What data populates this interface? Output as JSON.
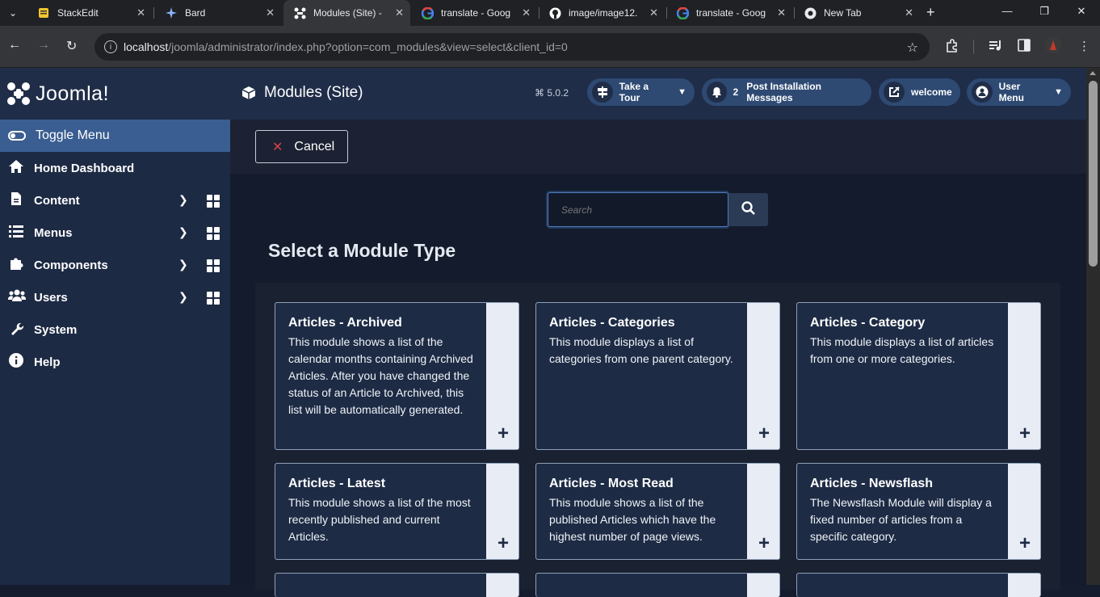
{
  "browser": {
    "tabs": [
      {
        "title": "StackEdit",
        "icon": "stackedit-icon",
        "active": false
      },
      {
        "title": "Bard",
        "icon": "bard-icon",
        "active": false
      },
      {
        "title": "Modules (Site) -",
        "icon": "joomla-icon",
        "active": true
      },
      {
        "title": "translate - Goog",
        "icon": "google-icon",
        "active": false
      },
      {
        "title": "image/image12.",
        "icon": "github-icon",
        "active": false
      },
      {
        "title": "translate - Goog",
        "icon": "google-icon",
        "active": false
      },
      {
        "title": "New Tab",
        "icon": "chrome-icon",
        "active": false
      }
    ],
    "url_host": "localhost",
    "url_path": "/joomla/administrator/index.php?option=com_modules&view=select&client_id=0"
  },
  "sidebar": {
    "logo": "Joomla!",
    "toggle_label": "Toggle Menu",
    "items": [
      {
        "label": "Home Dashboard",
        "icon": "home-icon",
        "has_submenu": false
      },
      {
        "label": "Content",
        "icon": "file-icon",
        "has_submenu": true
      },
      {
        "label": "Menus",
        "icon": "list-icon",
        "has_submenu": true
      },
      {
        "label": "Components",
        "icon": "puzzle-icon",
        "has_submenu": true
      },
      {
        "label": "Users",
        "icon": "users-icon",
        "has_submenu": true
      },
      {
        "label": "System",
        "icon": "wrench-icon",
        "has_submenu": false
      },
      {
        "label": "Help",
        "icon": "info-icon",
        "has_submenu": false
      }
    ]
  },
  "header": {
    "title": "Modules (Site)",
    "version": "5.0.2",
    "take_tour": "Take a Tour",
    "post_install_count": "2",
    "post_install_label": "Post Installation Messages",
    "welcome": "welcome",
    "user_menu": "User Menu"
  },
  "toolbar": {
    "cancel_label": "Cancel"
  },
  "search": {
    "placeholder": "Search"
  },
  "main": {
    "section_title": "Select a Module Type",
    "cards": [
      {
        "name": "Articles - Archived",
        "desc": "This module shows a list of the calendar months containing Archived Articles. After you have changed the status of an Article to Archived, this list will be automatically generated."
      },
      {
        "name": "Articles - Categories",
        "desc": "This module displays a list of categories from one parent category."
      },
      {
        "name": "Articles - Category",
        "desc": "This module displays a list of articles from one or more categories."
      },
      {
        "name": "Articles - Latest",
        "desc": "This module shows a list of the most recently published and current Articles."
      },
      {
        "name": "Articles - Most Read",
        "desc": "This module shows a list of the published Articles which have the highest number of page views."
      },
      {
        "name": "Articles - Newsflash",
        "desc": "The Newsflash Module will display a fixed number of articles from a specific category."
      }
    ]
  }
}
